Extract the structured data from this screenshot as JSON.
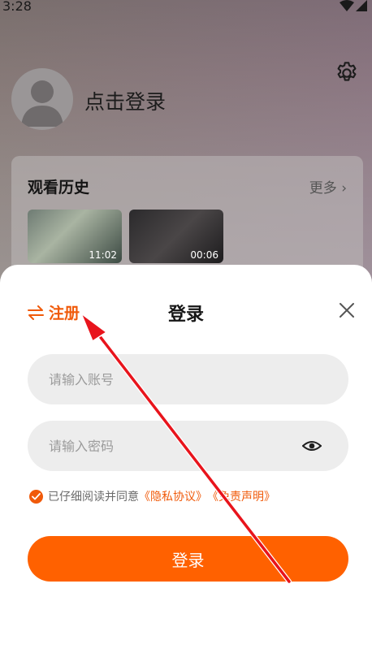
{
  "status_bar": {
    "time": "3:28"
  },
  "profile": {
    "login_prompt": "点击登录"
  },
  "history": {
    "title": "观看历史",
    "more": "更多",
    "items": [
      {
        "duration": "11:02"
      },
      {
        "duration": "00:06"
      }
    ]
  },
  "login_sheet": {
    "register_label": "注册",
    "title": "登录",
    "account_placeholder": "请输入账号",
    "password_placeholder": "请输入密码",
    "agreement": {
      "prefix": "已仔细阅读并同意",
      "privacy": "《隐私协议》",
      "disclaimer": "《免责声明》"
    },
    "submit_label": "登录"
  },
  "colors": {
    "accent": "#ff6100",
    "accent_text": "#f05a0a",
    "annotation_arrow": "#e8141c"
  },
  "icons": [
    "settings-gear-icon",
    "swap-arrows-icon",
    "close-icon",
    "eye-icon",
    "checkmark-icon",
    "chevron-right-icon",
    "wifi-icon",
    "signal-icon"
  ]
}
